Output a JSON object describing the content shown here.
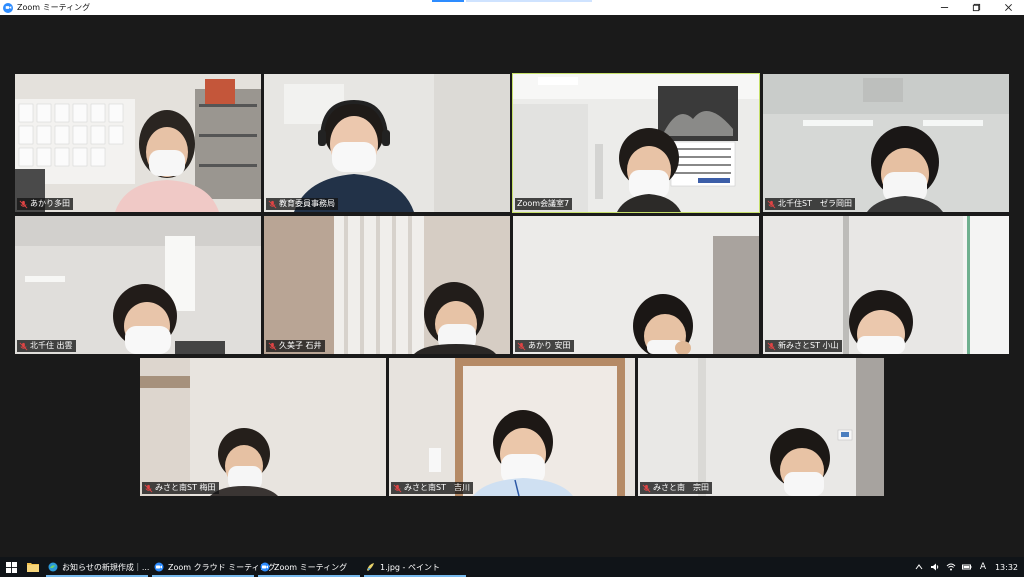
{
  "window": {
    "title": "Zoom ミーティング",
    "icon": "zoom-logo-icon",
    "controls": [
      "minimize-icon",
      "maximize-icon",
      "close-icon"
    ]
  },
  "participants": [
    {
      "name": "あかり多田",
      "active": false
    },
    {
      "name": "教育委員事務局",
      "active": false
    },
    {
      "name": "Zoom会議室7",
      "active": true
    },
    {
      "name": "北千住ST　ゼラ岡田",
      "active": false
    },
    {
      "name": "北千住 出雲",
      "active": false
    },
    {
      "name": "久美子 石井",
      "active": false
    },
    {
      "name": "あかり 安田",
      "active": false
    },
    {
      "name": "新みさとST 小山",
      "active": false
    },
    {
      "name": "みさと南ST 梅田",
      "active": false
    },
    {
      "name": "みさと南ST　吉川",
      "active": false
    },
    {
      "name": "みさと南　宗田",
      "active": false
    }
  ],
  "taskbar": {
    "items": [
      {
        "label": "お知らせの新規作成｜...",
        "icon": "edge-icon"
      },
      {
        "label": "Zoom クラウド ミーティング",
        "icon": "zoom-icon"
      },
      {
        "label": "Zoom ミーティング",
        "icon": "zoom-icon"
      },
      {
        "label": "1.jpg - ペイント",
        "icon": "paint-icon"
      }
    ],
    "ime": "A",
    "time": "13:32"
  }
}
